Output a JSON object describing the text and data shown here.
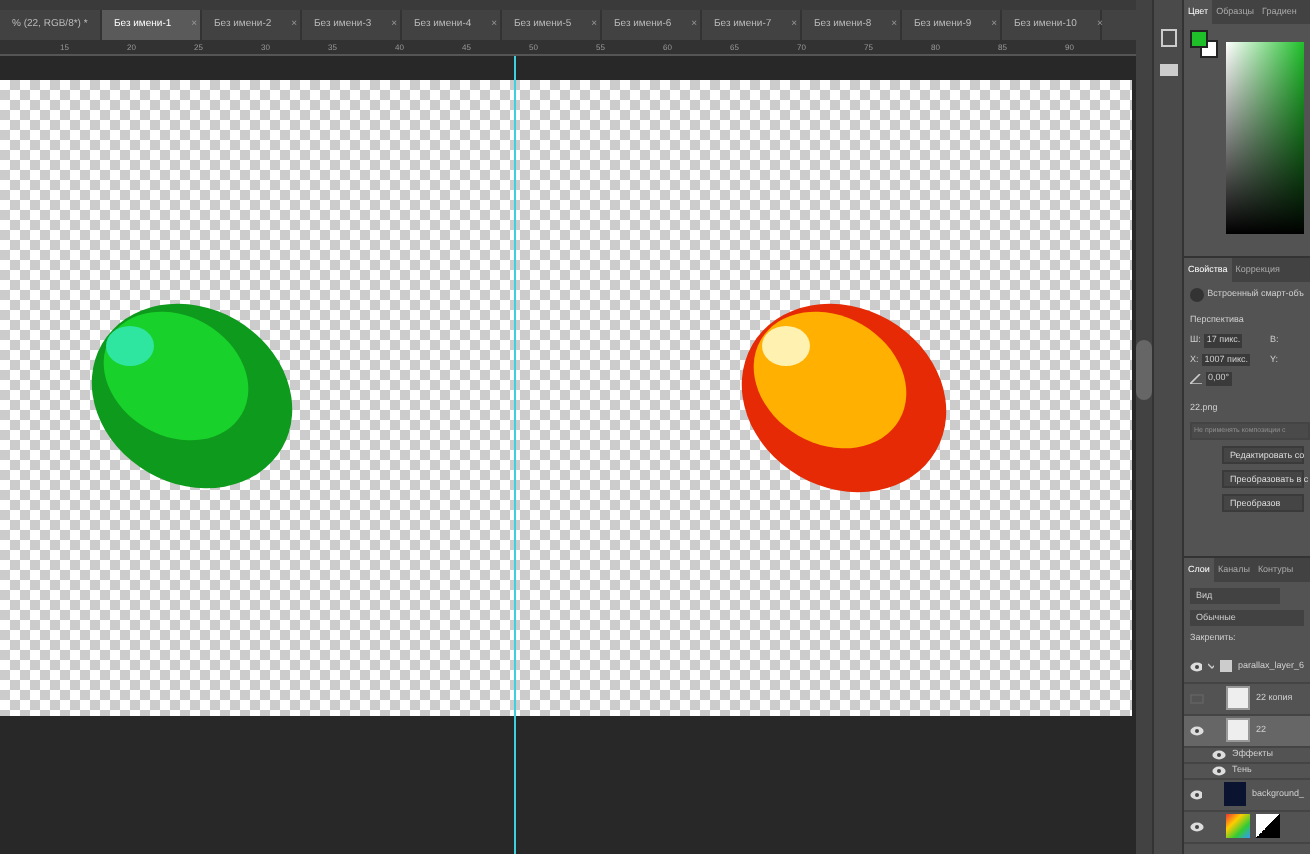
{
  "tabs": [
    {
      "label": "% (22, RGB/8*) *",
      "selected": false
    },
    {
      "label": "Без имени-1",
      "selected": true
    },
    {
      "label": "Без имени-2",
      "selected": false
    },
    {
      "label": "Без имени-3",
      "selected": false
    },
    {
      "label": "Без имени-4",
      "selected": false
    },
    {
      "label": "Без имени-5",
      "selected": false
    },
    {
      "label": "Без имени-6",
      "selected": false
    },
    {
      "label": "Без имени-7",
      "selected": false
    },
    {
      "label": "Без имени-8",
      "selected": false
    },
    {
      "label": "Без имени-9",
      "selected": false
    },
    {
      "label": "Без имени-10",
      "selected": false
    }
  ],
  "ruler": [
    "15",
    "20",
    "25",
    "30",
    "35",
    "40",
    "45",
    "50",
    "55",
    "60",
    "65",
    "70",
    "75",
    "80",
    "85",
    "90"
  ],
  "tab_close": "×",
  "color_panel": {
    "tabs": [
      {
        "label": "Цвет",
        "selected": true
      },
      {
        "label": "Образцы",
        "selected": false
      },
      {
        "label": "Градиен",
        "selected": false
      }
    ]
  },
  "properties": {
    "tabs": [
      {
        "label": "Свойства",
        "selected": true
      },
      {
        "label": "Коррекция",
        "selected": false
      }
    ],
    "type": "Встроенный смарт-объ",
    "section": "Перспектива",
    "fields": [
      {
        "label": "Ш:",
        "value": "17 пикс."
      },
      {
        "label": "В:"
      },
      {
        "label": "X:",
        "value": "1007 пикс."
      },
      {
        "label": "Y:"
      }
    ],
    "angle": "0,00°",
    "file": "22.png",
    "comp_placeholder": "Не применять композиции с",
    "buttons": [
      "Редактировать со",
      "Преобразовать в с",
      "Преобразов"
    ]
  },
  "layers": {
    "tabs": [
      {
        "label": "Слои",
        "selected": true
      },
      {
        "label": "Каналы",
        "selected": false
      },
      {
        "label": "Контуры",
        "selected": false
      }
    ],
    "filter": "Вид",
    "blend": "Обычные",
    "lock_label": "Закрепить:",
    "items": [
      {
        "kind": "group",
        "name": "parallax_layer_6",
        "visible": true,
        "selected": false,
        "expanded": true
      },
      {
        "kind": "layer",
        "name": "22 копия",
        "visible": false,
        "selected": false
      },
      {
        "kind": "layer",
        "name": "22",
        "visible": true,
        "selected": true
      },
      {
        "kind": "effect",
        "name": "Эффекты",
        "visible": true,
        "selected": false
      },
      {
        "kind": "effect",
        "name": "Тень",
        "visible": true,
        "selected": false
      },
      {
        "kind": "dark",
        "name": "background_",
        "visible": true,
        "selected": false
      },
      {
        "kind": "adjust",
        "visible": true,
        "selected": false
      }
    ]
  }
}
